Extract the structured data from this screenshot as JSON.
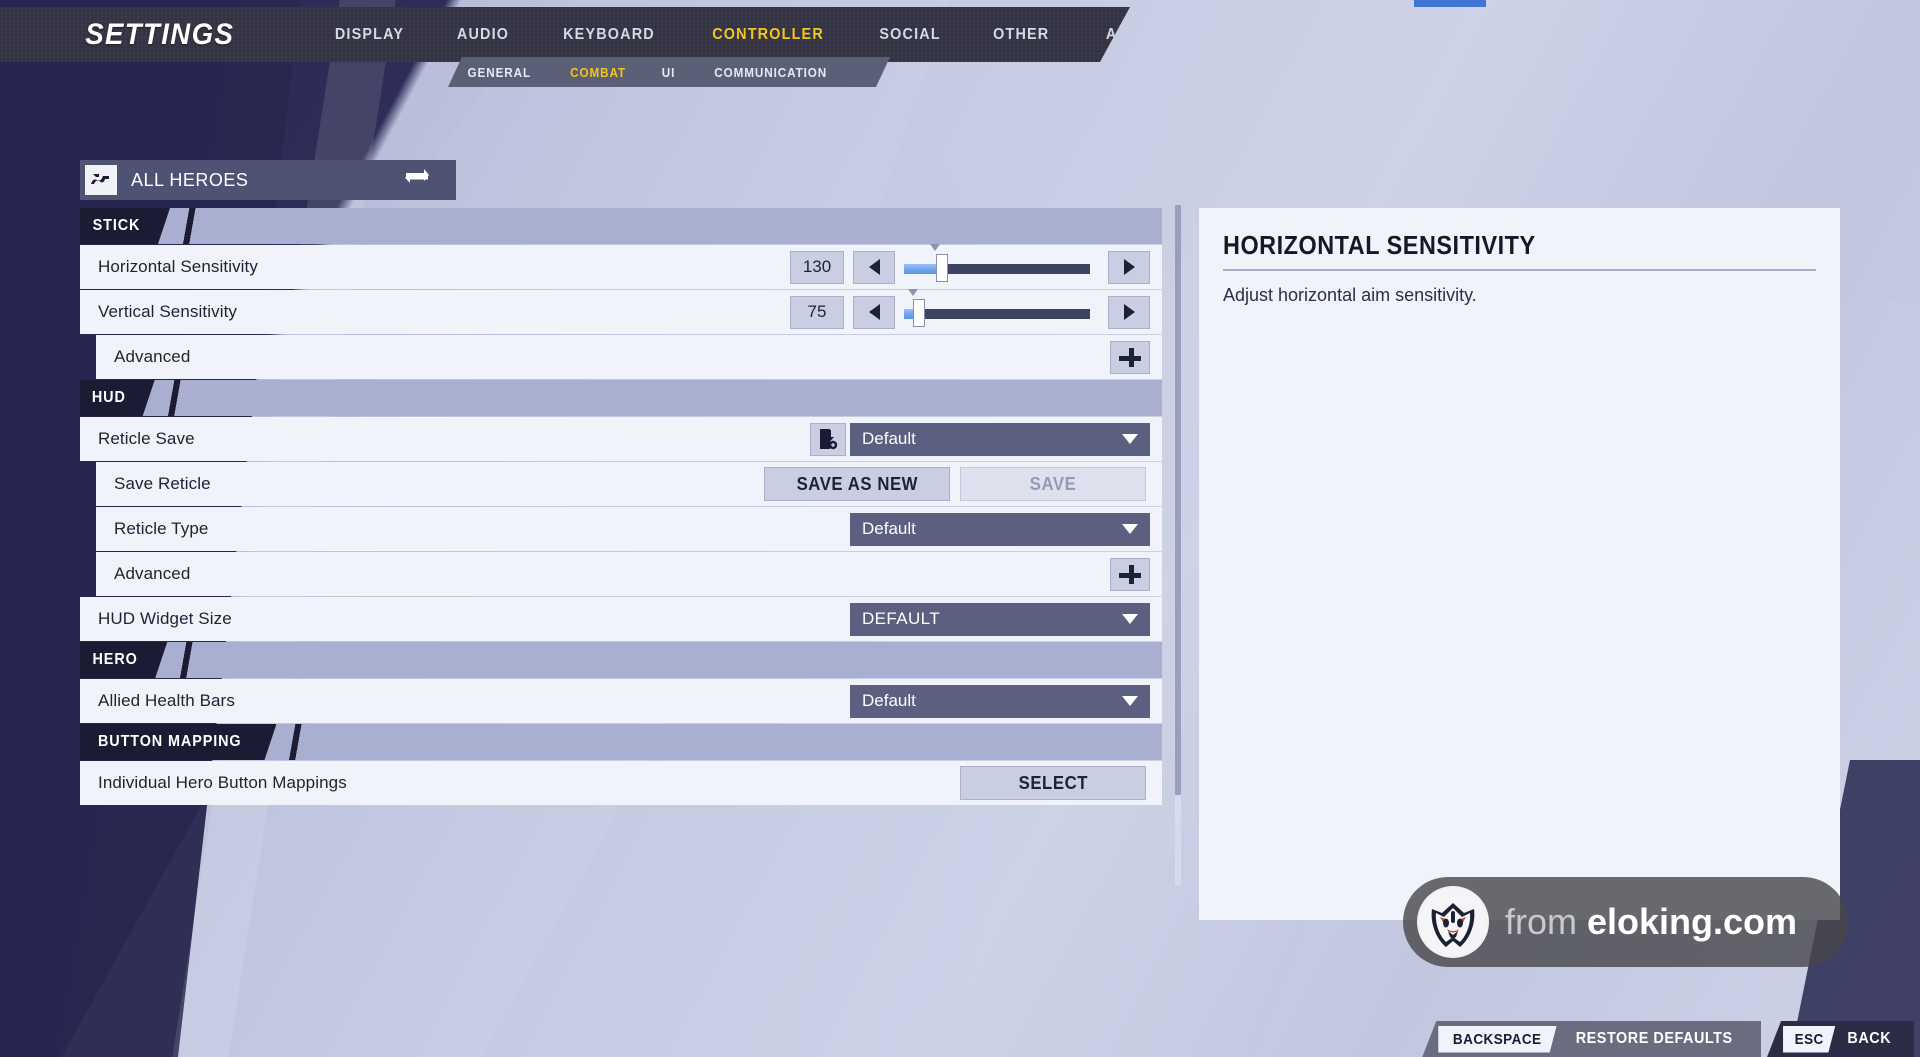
{
  "header": {
    "title": "SETTINGS",
    "nav": [
      {
        "label": "DISPLAY",
        "active": false
      },
      {
        "label": "AUDIO",
        "active": false
      },
      {
        "label": "KEYBOARD",
        "active": false
      },
      {
        "label": "CONTROLLER",
        "active": true
      },
      {
        "label": "SOCIAL",
        "active": false
      },
      {
        "label": "OTHER",
        "active": false
      },
      {
        "label": "ACCESSIBILITY",
        "active": false
      }
    ],
    "subtabs": [
      {
        "label": "GENERAL",
        "active": false
      },
      {
        "label": "COMBAT",
        "active": true
      },
      {
        "label": "UI",
        "active": false
      },
      {
        "label": "COMMUNICATION",
        "active": false
      }
    ],
    "accent_color": "#f5c518"
  },
  "hero_selector": {
    "label": "ALL HEROES",
    "logo_icon": "overwatch-logo-icon",
    "swap_icon": "swap-arrows-icon"
  },
  "sections": [
    {
      "tag": "STICK",
      "rows": [
        {
          "label": "Horizontal Sensitivity",
          "type": "slider",
          "value": "130",
          "fill_percent": 17,
          "thumb_percent": 17
        },
        {
          "label": "Vertical Sensitivity",
          "type": "slider",
          "value": "75",
          "fill_percent": 5,
          "thumb_percent": 5
        },
        {
          "label": "Advanced",
          "type": "expander",
          "indent": true,
          "expand_icon": "plus-icon"
        }
      ]
    },
    {
      "tag": "HUD",
      "rows": [
        {
          "label": "Reticle Save",
          "type": "dropdown-with-icon",
          "value": "Default",
          "icon": "save-reticle-icon"
        },
        {
          "label": "Save Reticle",
          "type": "buttons",
          "indent": true,
          "buttons": [
            {
              "label": "SAVE AS NEW",
              "disabled": false
            },
            {
              "label": "SAVE",
              "disabled": true
            }
          ]
        },
        {
          "label": "Reticle Type",
          "type": "dropdown",
          "indent": true,
          "value": "Default"
        },
        {
          "label": "Advanced",
          "type": "expander",
          "indent": true,
          "expand_icon": "plus-icon"
        },
        {
          "label": "HUD Widget Size",
          "type": "dropdown",
          "value": "DEFAULT"
        }
      ]
    },
    {
      "tag": "HERO",
      "rows": [
        {
          "label": "Allied Health Bars",
          "type": "dropdown",
          "value": "Default"
        }
      ]
    },
    {
      "tag": "BUTTON MAPPING",
      "rows": [
        {
          "label": "Individual Hero Button Mappings",
          "type": "button",
          "button": {
            "label": "SELECT",
            "disabled": false
          }
        }
      ]
    }
  ],
  "info_panel": {
    "title": "HORIZONTAL SENSITIVITY",
    "description": "Adjust horizontal aim sensitivity."
  },
  "watermark": {
    "from_text": "from ",
    "domain": "eloking.com",
    "logo_icon": "tiger-head-logo-icon"
  },
  "footer": {
    "hints": [
      {
        "key": "BACKSPACE",
        "action": "RESTORE DEFAULTS"
      },
      {
        "key": "ESC",
        "action": "BACK"
      }
    ]
  }
}
